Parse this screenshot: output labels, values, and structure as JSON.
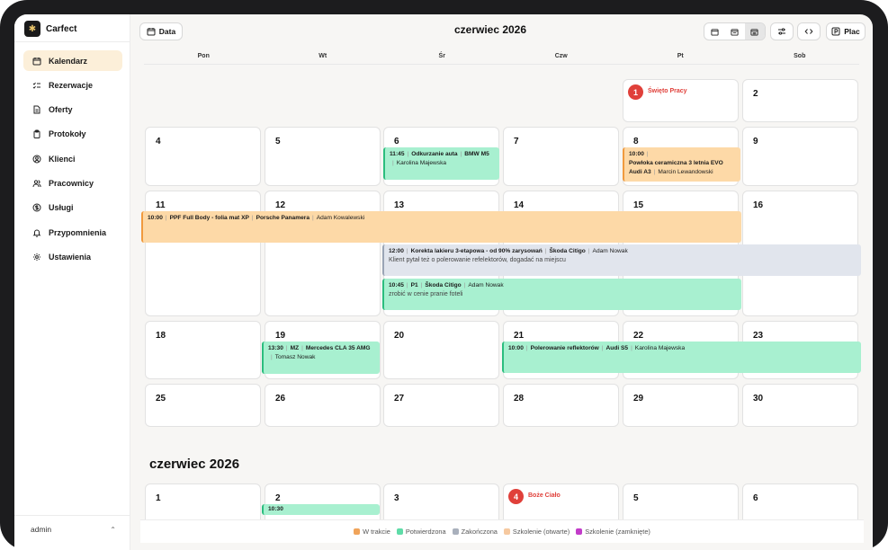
{
  "app": {
    "name": "Carfect"
  },
  "sidebar": {
    "items": [
      {
        "label": "Kalendarz",
        "icon": "calendar-icon",
        "active": true
      },
      {
        "label": "Rezerwacje",
        "icon": "list-check-icon"
      },
      {
        "label": "Oferty",
        "icon": "document-icon"
      },
      {
        "label": "Protokoły",
        "icon": "clipboard-icon"
      },
      {
        "label": "Klienci",
        "icon": "user-circle-icon"
      },
      {
        "label": "Pracownicy",
        "icon": "users-icon"
      },
      {
        "label": "Usługi",
        "icon": "dollar-circle-icon"
      },
      {
        "label": "Przypomnienia",
        "icon": "bell-icon"
      },
      {
        "label": "Ustawienia",
        "icon": "gear-icon"
      }
    ],
    "user": "admin"
  },
  "toolbar": {
    "date_label": "Data",
    "title": "czerwiec 2026",
    "plac_label": "Plac"
  },
  "weekdays": [
    "Pon",
    "Wt",
    "Śr",
    "Czw",
    "Pt",
    "Sob"
  ],
  "days": {
    "d1": "1",
    "d2": "2",
    "d4": "4",
    "d5": "5",
    "d6": "6",
    "d7": "7",
    "d8": "8",
    "d9": "9",
    "d11": "11",
    "d12": "12",
    "d13": "13",
    "d14": "14",
    "d15": "15",
    "d16": "16",
    "d18": "18",
    "d19": "19",
    "d20": "20",
    "d21": "21",
    "d22": "22",
    "d23": "23",
    "d25": "25",
    "d26": "26",
    "d27": "27",
    "d28": "28",
    "d29": "29",
    "d30": "30"
  },
  "holidays": {
    "h1": "Święto Pracy",
    "h2_num": "4",
    "h2": "Boże Ciało"
  },
  "events": {
    "e1": {
      "time": "11:45",
      "service": "Odkurzanie auta",
      "car": "BMW M5",
      "person": "Karolina Majewska"
    },
    "e2": {
      "time": "10:00",
      "service": "Powłoka ceramiczna 3 letnia EVO",
      "car": "Audi A3",
      "person": "Marcin Lewandowski"
    },
    "e3": {
      "time": "10:00",
      "service": "PPF Full Body - folia mat XP",
      "car": "Porsche Panamera",
      "person": "Adam Kowalewski"
    },
    "e4": {
      "time": "12:00",
      "service": "Korekta lakieru 3-etapowa - od 90% zarysowań",
      "car": "Škoda Citigo",
      "person": "Adam Nowak",
      "note": "Klient pytał też o polerowanie refelektorów, dogadać na miejscu"
    },
    "e5": {
      "time": "10:45",
      "service": "P1",
      "car": "Škoda Citigo",
      "person": "Adam Nowak",
      "note": "zrobić w cenie pranie foteli"
    },
    "e6": {
      "time": "13:30",
      "service": "MZ",
      "car": "Mercedes CLA 35 AMG",
      "person": "Tomasz Nowak"
    },
    "e7": {
      "time": "10:00",
      "service": "Polerowanie reflektorów",
      "car": "Audi S5",
      "person": "Karolina Majewska"
    },
    "e8": {
      "time": "10:30"
    }
  },
  "month2": {
    "title": "czerwiec 2026",
    "d1": "1",
    "d2": "2",
    "d3": "3",
    "d5": "5",
    "d6": "6"
  },
  "legend": [
    {
      "label": "W trakcie",
      "color": "#f0a45a"
    },
    {
      "label": "Potwierdzona",
      "color": "#5fdca8"
    },
    {
      "label": "Zakończona",
      "color": "#a9b0bc"
    },
    {
      "label": "Szkolenie (otwarte)",
      "color": "#f6c9a0"
    },
    {
      "label": "Szkolenie (zamknięte)",
      "color": "#c23cc9"
    }
  ]
}
